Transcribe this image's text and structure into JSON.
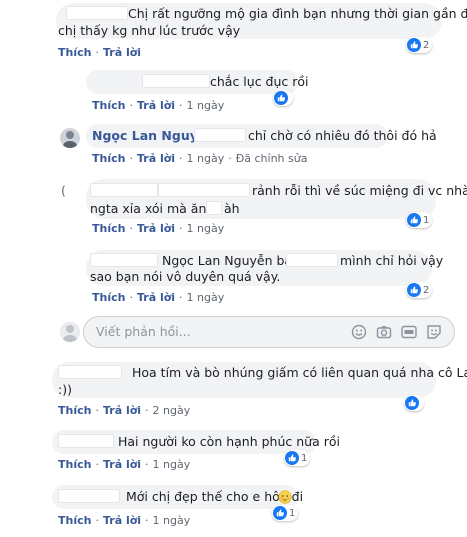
{
  "actions": {
    "like": "Thích",
    "reply": "Trả lời",
    "separator": "·",
    "edited": "Đã chỉnh sửa"
  },
  "comments": [
    {
      "lines": [
        "Chị rất ngưỡng mộ gia đình bạn nhưng thời gian gần đây",
        "chị thấy kg như lúc trước vậy"
      ],
      "time": "",
      "reactions": "2"
    },
    {
      "lines": [
        "chắc lục đục rồi"
      ],
      "time": "1 ngày",
      "reactions": ""
    },
    {
      "author": "Ngọc Lan Nguyễn",
      "lines": [
        "chỉ chờ có nhiêu đó thôi đó hả"
      ],
      "time": "1 ngày",
      "edited": "Đã chỉnh sửa"
    },
    {
      "lines": [
        "rảnh rỗi thì về súc miệng đi vc nhà",
        "ngta xỉa xói mà ăn",
        "àh"
      ],
      "time": "1 ngày",
      "reactions": "1",
      "prefix": "("
    },
    {
      "lines": [
        "Ngọc Lan Nguyễn bạn",
        "mình chỉ hỏi vậy",
        "sao bạn nói vô duyên quá vậy."
      ],
      "time": "1 ngày",
      "reactions": "2"
    },
    {
      "lines": [
        "Hoa tím và bò nhúng giấm có liên quan quá nha cô Lan",
        ":))"
      ],
      "time": "2 ngày",
      "reactions": ""
    },
    {
      "lines": [
        "Hai người ko còn hạnh phúc nữa rồi"
      ],
      "time": "1 ngày",
      "reactions": "1"
    },
    {
      "lines": [
        "Mới chị đẹp thế cho e hôn đi"
      ],
      "time": "1 ngày",
      "reactions": "1"
    }
  ],
  "reply_input": {
    "placeholder": "Viết phản hồi..."
  },
  "icons": [
    "like-icon",
    "emoji-icon",
    "camera-icon",
    "gif-icon",
    "sticker-icon",
    "shy-emoji-icon"
  ],
  "colors": {
    "link": "#385898",
    "like": "#1877f2",
    "bubble": "#f2f3f5"
  }
}
